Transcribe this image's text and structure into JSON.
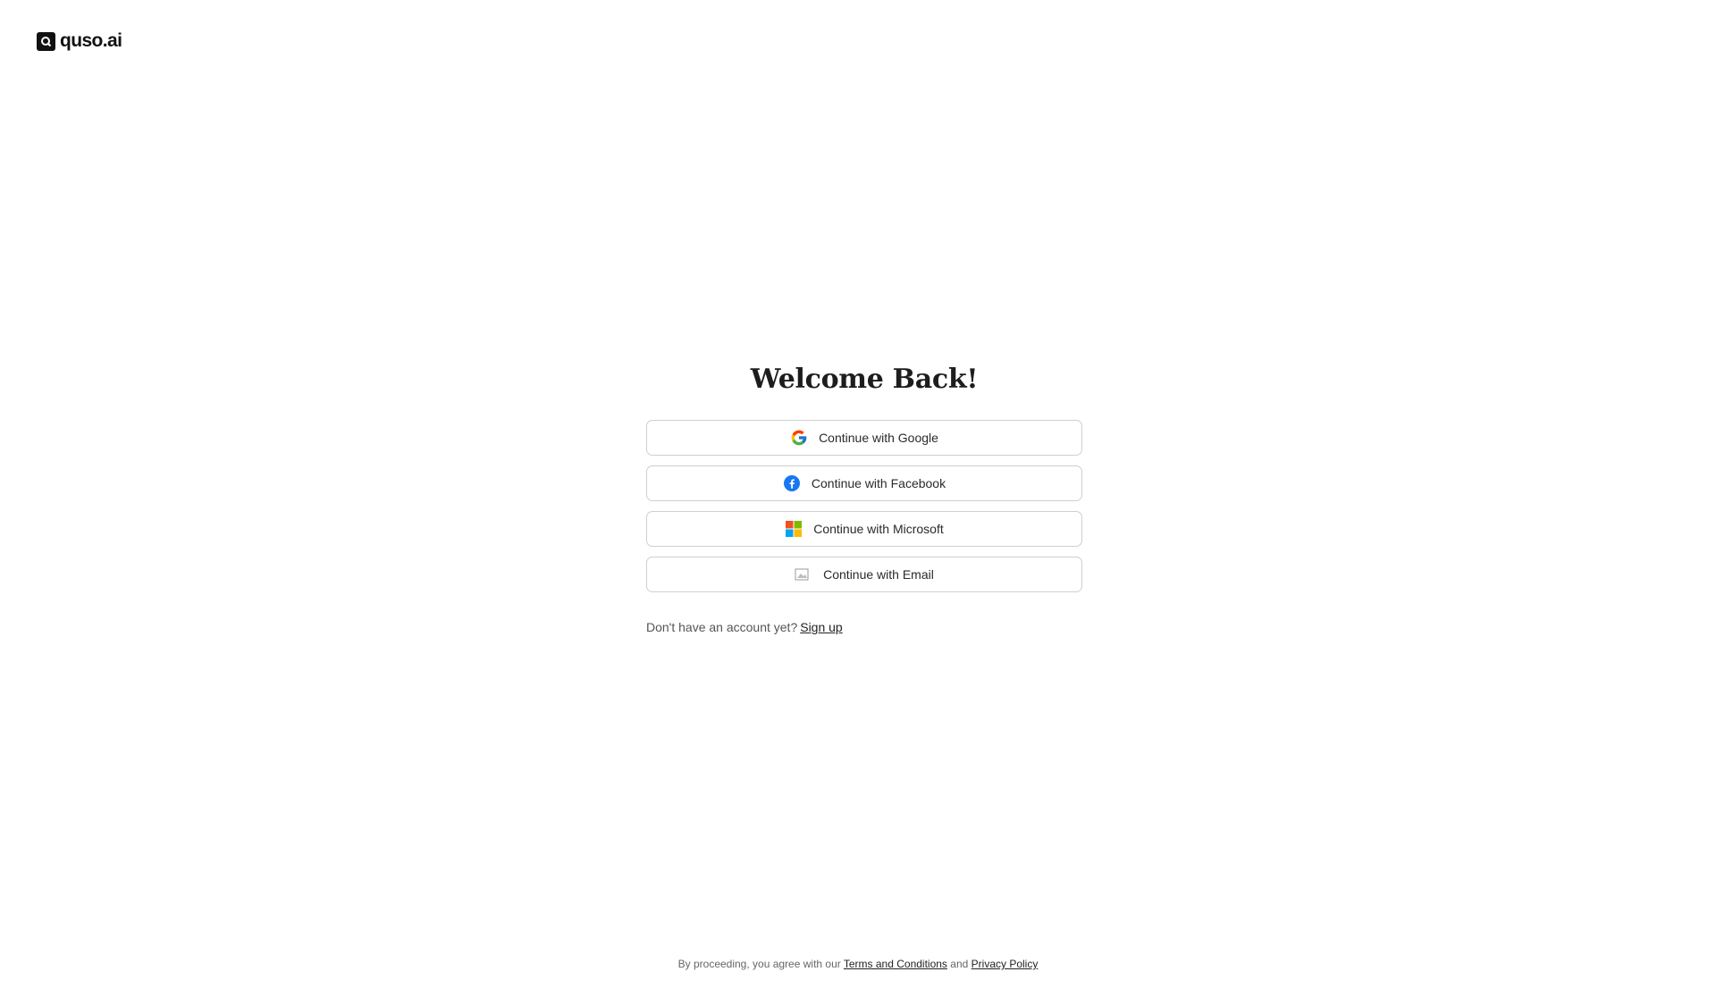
{
  "brand": {
    "name": "quso.ai"
  },
  "login": {
    "title": "Welcome Back!",
    "buttons": [
      {
        "label": "Continue with Google",
        "icon": "google-icon"
      },
      {
        "label": "Continue with Facebook",
        "icon": "facebook-icon"
      },
      {
        "label": "Continue with Microsoft",
        "icon": "microsoft-icon"
      },
      {
        "label": "Continue with Email",
        "icon": "email-icon"
      }
    ],
    "signup_prompt": "Don't have an account yet?",
    "signup_link": "Sign up"
  },
  "footer": {
    "prefix": "By proceeding, you agree with our",
    "terms": "Terms and Conditions",
    "and": "and",
    "privacy": "Privacy Policy"
  },
  "colors": {
    "border": "#cfcfcf",
    "facebook": "#1877F2",
    "ms_red": "#F25022",
    "ms_green": "#7FBA00",
    "ms_blue": "#00A4EF",
    "ms_yellow": "#FFB900"
  }
}
